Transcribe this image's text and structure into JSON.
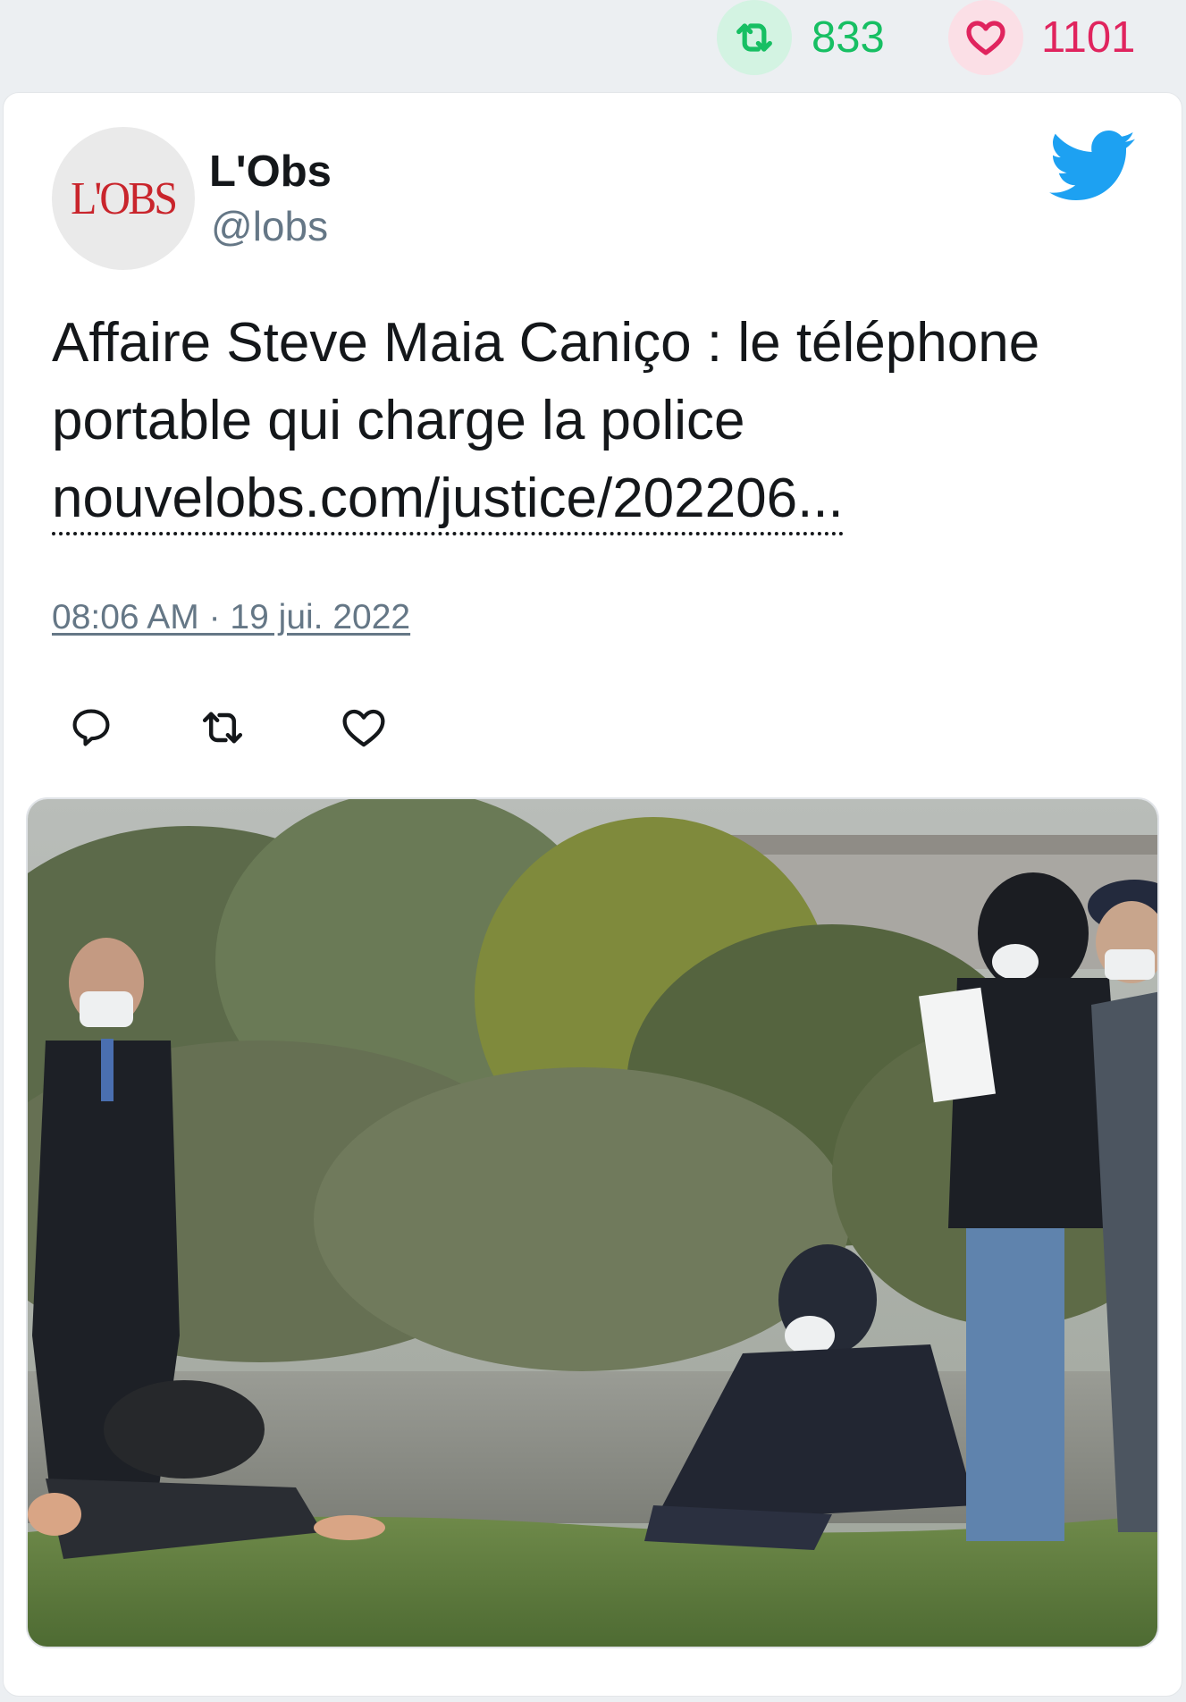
{
  "stats": {
    "retweet_count": "833",
    "like_count": "1101",
    "retweet_color": "#17bf63",
    "like_color": "#e0245e"
  },
  "tweet": {
    "avatar_logo_text": "L'OBS",
    "display_name": "L'Obs",
    "handle": "@lobs",
    "text": "Affaire Steve Maia Caniço : le téléphone portable qui charge la police",
    "link_text": "nouvelobs.com/justice/202206...",
    "timestamp": "08:06 AM · 19 jui. 2022",
    "platform_icon": "twitter-bird-icon",
    "accent_color": "#1da1f2"
  },
  "actions": {
    "reply_icon": "reply-icon",
    "retweet_icon": "retweet-icon",
    "like_icon": "heart-icon"
  },
  "media": {
    "type": "photo"
  }
}
